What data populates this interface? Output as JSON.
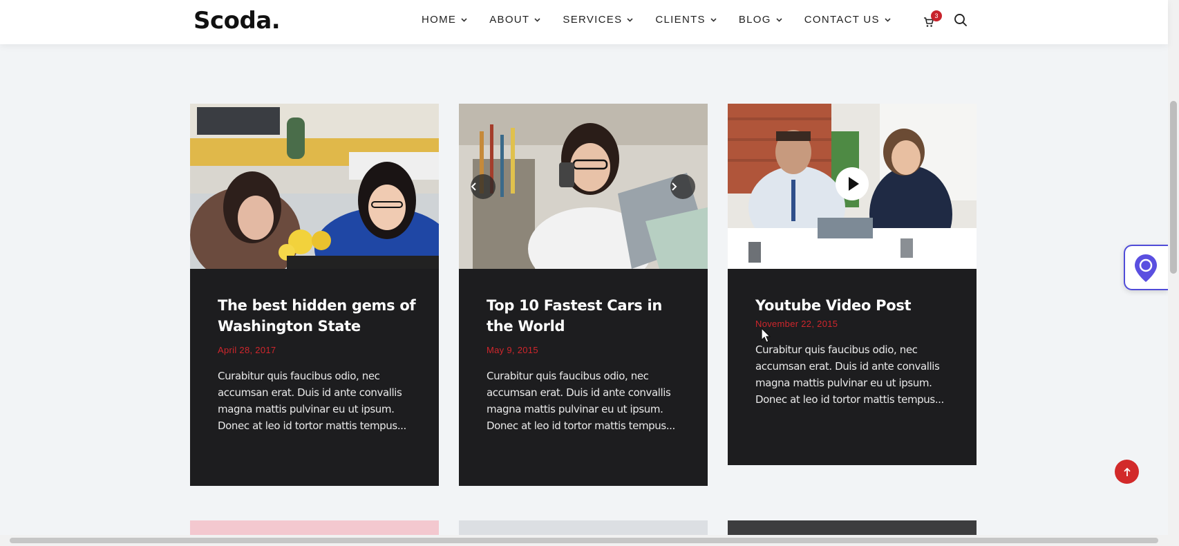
{
  "brand": {
    "logo": "Scoda."
  },
  "nav": [
    {
      "label": "HOME"
    },
    {
      "label": "ABOUT"
    },
    {
      "label": "SERVICES"
    },
    {
      "label": "CLIENTS"
    },
    {
      "label": "BLOG"
    },
    {
      "label": "CONTACT US"
    }
  ],
  "cart": {
    "count": "3"
  },
  "posts": [
    {
      "title": "The best hidden gems of Washington State",
      "date": "April 28, 2017",
      "excerpt": "Curabitur quis faucibus odio, nec accumsan erat. Duis id ante convallis magna mattis pulvinar eu ut ipsum. Donec at leo id tortor mattis tempus..."
    },
    {
      "title": "Top 10 Fastest Cars in the World",
      "date": "May 9, 2015",
      "excerpt": "Curabitur quis faucibus odio, nec accumsan erat. Duis id ante convallis magna mattis pulvinar eu ut ipsum. Donec at leo id tortor mattis tempus..."
    },
    {
      "title": "Youtube Video Post",
      "date": "November 22, 2015",
      "excerpt": "Curabitur quis faucibus odio, nec accumsan erat. Duis id ante convallis magna mattis pulvinar eu ut ipsum. Donec at leo id tortor mattis tempus..."
    }
  ],
  "icons": {
    "cart": "cart-icon",
    "search": "search-icon",
    "prev": "chevron-left-icon",
    "next": "chevron-right-icon",
    "play": "play-icon",
    "map": "map-pin-icon",
    "top": "arrow-up-icon"
  },
  "colors": {
    "accent": "#d0262c",
    "card_bg": "#1d1d1f",
    "page_bg": "#f2f4f6",
    "widget": "#4f4bd8"
  }
}
